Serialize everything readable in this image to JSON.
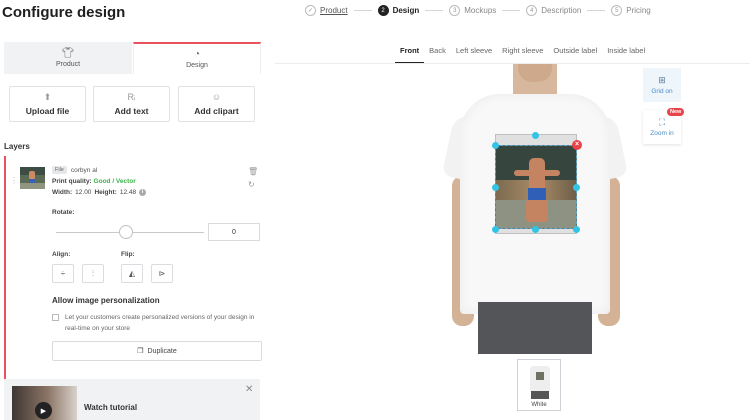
{
  "header": {
    "title": "Configure design",
    "steps": [
      {
        "num": "✓",
        "label": "Product",
        "state": "done"
      },
      {
        "num": "2",
        "label": "Design",
        "state": "active"
      },
      {
        "num": "3",
        "label": "Mockups",
        "state": "pending"
      },
      {
        "num": "4",
        "label": "Description",
        "state": "pending"
      },
      {
        "num": "5",
        "label": "Pricing",
        "state": "pending"
      }
    ]
  },
  "panel_tabs": {
    "product": {
      "label": "Product",
      "icon": "tshirt-icon"
    },
    "design": {
      "label": "Design",
      "icon": "palette-icon"
    }
  },
  "add_actions": {
    "upload": {
      "label": "Upload file",
      "icon": "upload-icon"
    },
    "text": {
      "label": "Add text",
      "icon": "text-icon"
    },
    "clipart": {
      "label": "Add clipart",
      "icon": "smiley-icon"
    }
  },
  "layers": {
    "heading": "Layers",
    "item": {
      "badge": "File",
      "name": "corbyn al",
      "print_quality_label": "Print quality:",
      "print_quality_value": "Good / Vector",
      "width_label": "Width:",
      "width_value": "12.00",
      "height_label": "Height:",
      "height_value": "12.48"
    },
    "rotate_label": "Rotate:",
    "rotate_value": "0",
    "align_label": "Align:",
    "flip_label": "Flip:",
    "personalization_title": "Allow image personalization",
    "personalization_desc": "Let your customers create personalized versions of your design in real-time on your store",
    "duplicate_label": "Duplicate"
  },
  "tutorial": {
    "label": "Watch tutorial"
  },
  "view_tabs": [
    "Front",
    "Back",
    "Left sleeve",
    "Right sleeve",
    "Outside label",
    "Inside label"
  ],
  "active_view": "Front",
  "tools": {
    "grid": "Grid on",
    "zoom": "Zoom in",
    "new_badge": "New"
  },
  "mockup": {
    "color_label": "White"
  },
  "colors": {
    "accent_red": "#e8535d",
    "good_green": "#3bb34a",
    "handle_blue": "#33c4e5"
  }
}
